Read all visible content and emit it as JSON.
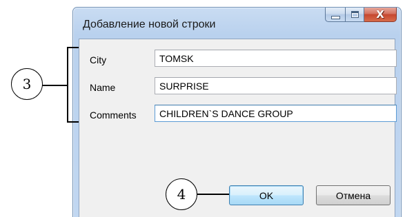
{
  "dialog": {
    "title": "Добавление новой строки",
    "caption_buttons": {
      "minimize_icon": "minimize-icon",
      "maximize_icon": "maximize-icon",
      "close_icon": "close-icon",
      "close_glyph": "X"
    },
    "fields": [
      {
        "label": "City",
        "value": "TOMSK"
      },
      {
        "label": "Name",
        "value": "SURPRISE"
      },
      {
        "label": "Comments",
        "value": "CHILDREN`S DANCE GROUP"
      }
    ],
    "ok_label": "OK",
    "cancel_label": "Отмена"
  },
  "callouts": {
    "fields_marker": "3",
    "ok_marker": "4"
  },
  "colors": {
    "window_frame": "#b9d1ee",
    "close_button": "#c6472f",
    "focused_border": "#5b9bd5",
    "default_button": "#bee6fd"
  }
}
